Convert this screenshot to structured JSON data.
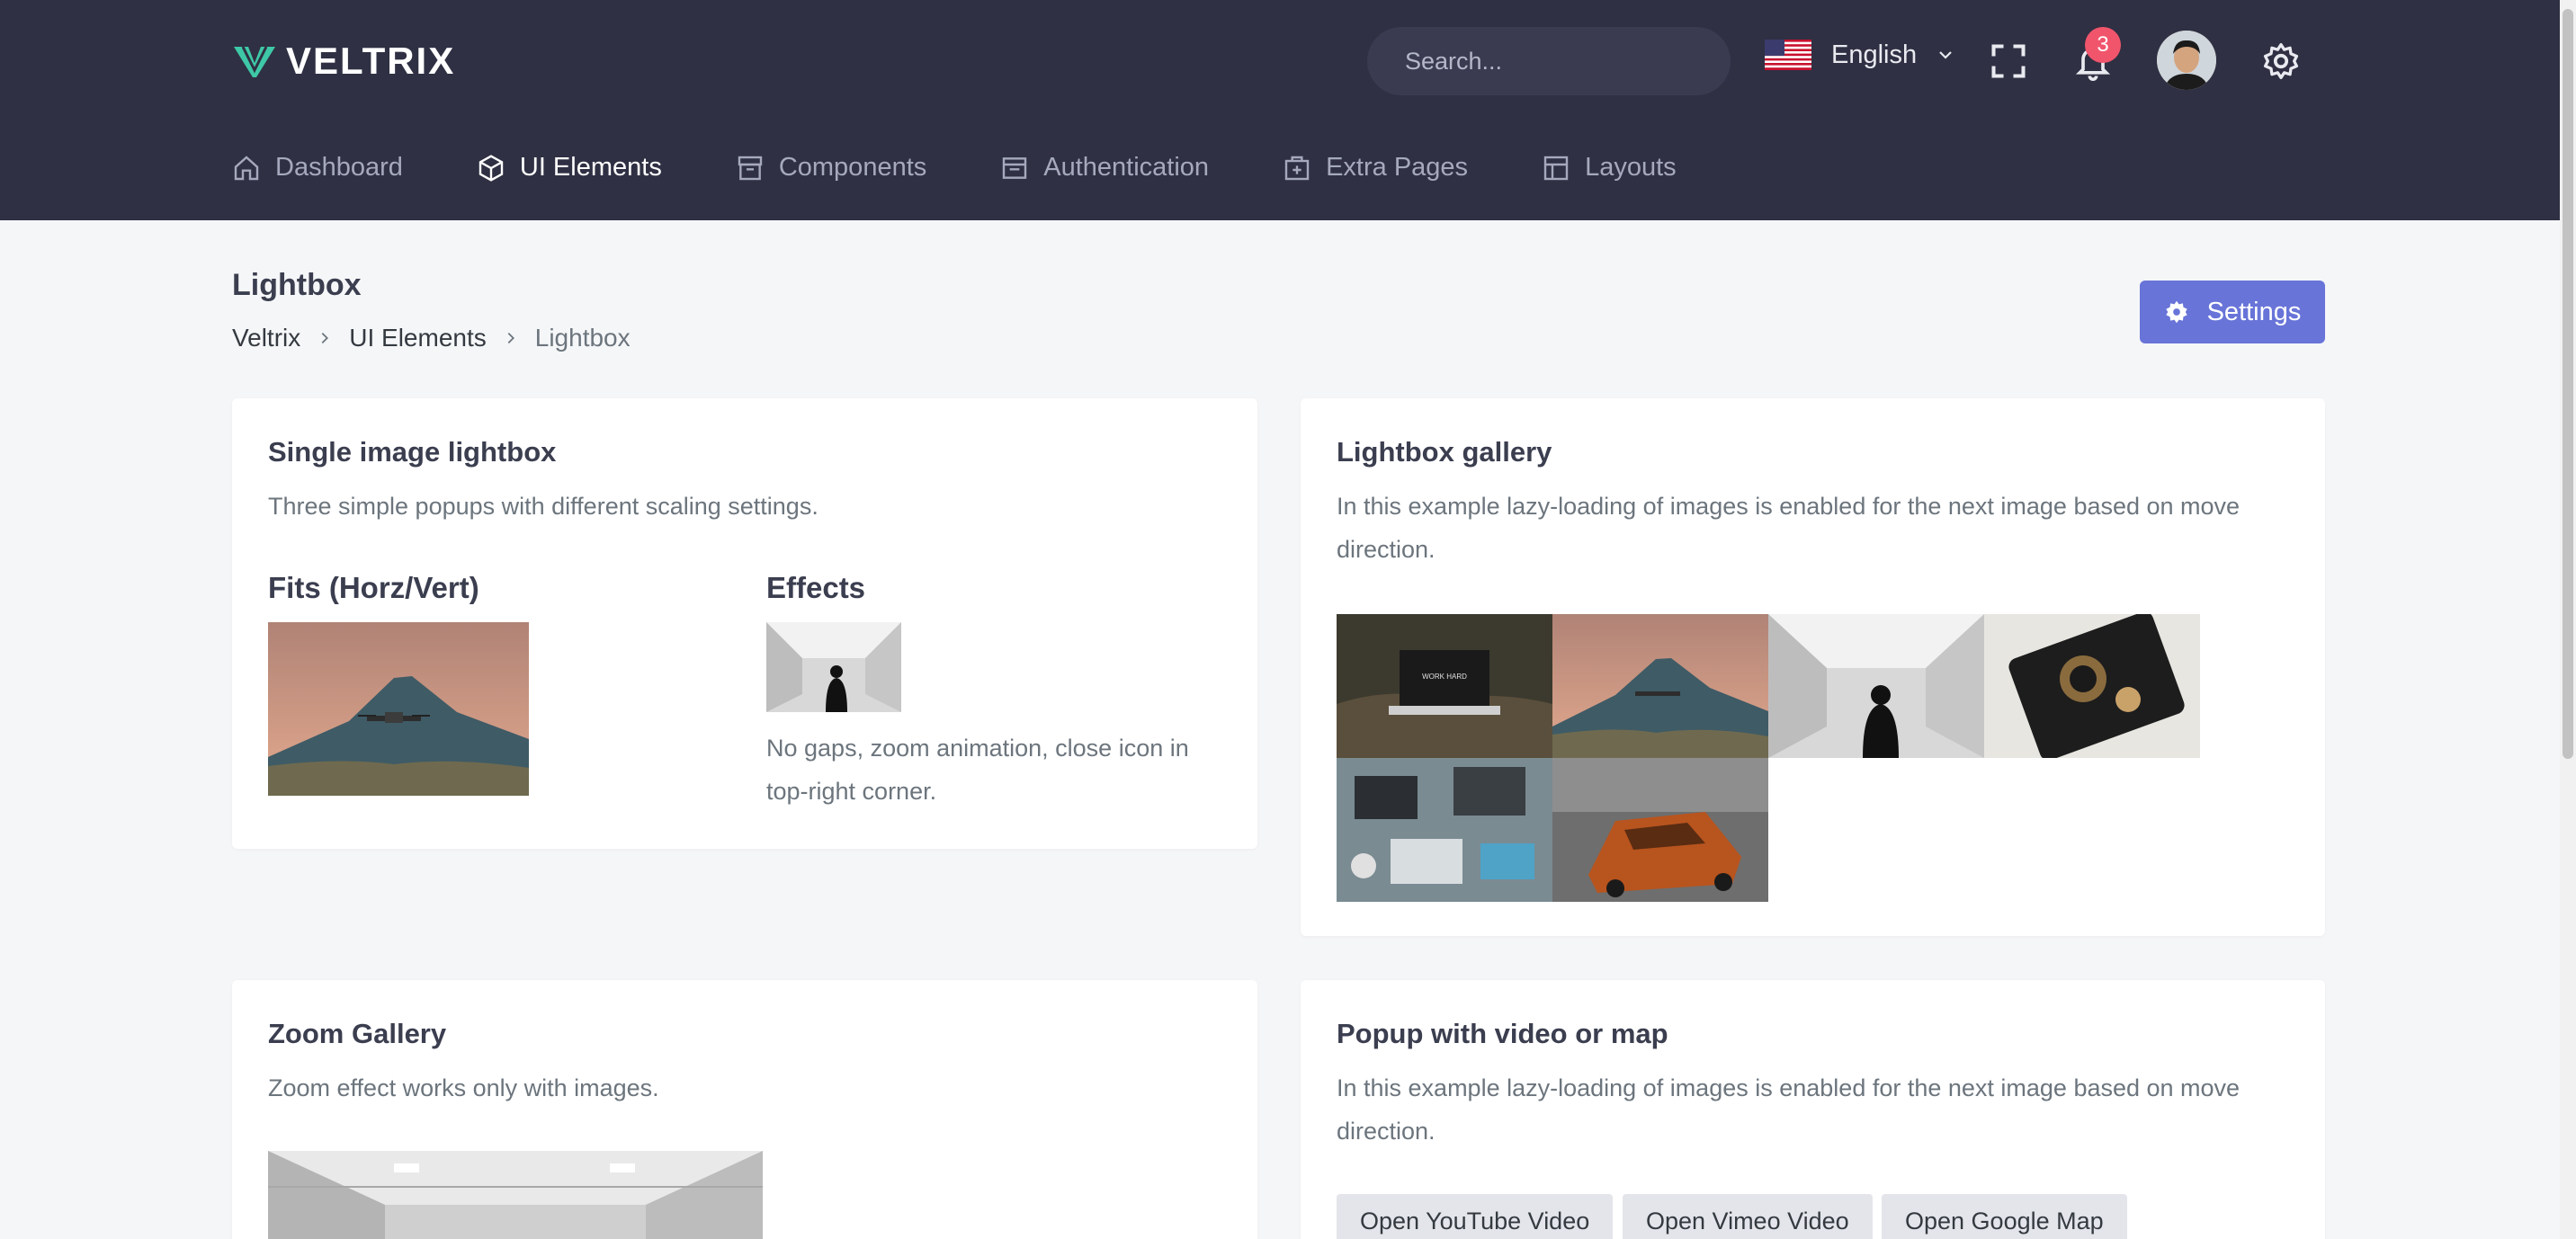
{
  "brand": {
    "name": "VELTRIX"
  },
  "header": {
    "search_placeholder": "Search...",
    "language": "English",
    "notification_count": "3"
  },
  "nav": [
    {
      "label": "Dashboard",
      "icon": "home-icon"
    },
    {
      "label": "UI Elements",
      "icon": "box-icon",
      "active": true
    },
    {
      "label": "Components",
      "icon": "archive-icon"
    },
    {
      "label": "Authentication",
      "icon": "inbox-icon"
    },
    {
      "label": "Extra Pages",
      "icon": "file-plus-icon"
    },
    {
      "label": "Layouts",
      "icon": "layout-icon"
    }
  ],
  "page": {
    "title": "Lightbox",
    "breadcrumb": [
      "Veltrix",
      "UI Elements",
      "Lightbox"
    ],
    "settings_label": "Settings"
  },
  "cards": {
    "single": {
      "title": "Single image lightbox",
      "desc": "Three simple popups with different scaling settings.",
      "fits_title": "Fits (Horz/Vert)",
      "effects_title": "Effects",
      "effects_caption": "No gaps, zoom animation, close icon in top-right corner."
    },
    "gallery": {
      "title": "Lightbox gallery",
      "desc": "In this example lazy-loading of images is enabled for the next image based on move direction."
    },
    "zoom": {
      "title": "Zoom Gallery",
      "desc": "Zoom effect works only with images."
    },
    "popup": {
      "title": "Popup with video or map",
      "desc": "In this example lazy-loading of images is enabled for the next image based on move direction.",
      "buttons": [
        "Open YouTube Video",
        "Open Vimeo Video",
        "Open Google Map"
      ]
    }
  },
  "colors": {
    "topbar": "#2f3043",
    "accent": "#6874d8",
    "brand_mark": "#3ec8a7",
    "badge": "#f1556c"
  }
}
